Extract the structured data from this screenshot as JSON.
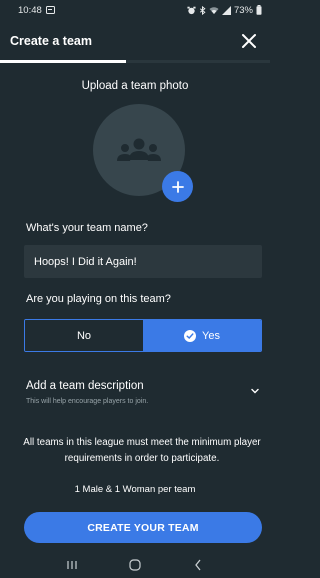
{
  "status_bar": {
    "time": "10:48",
    "battery": "73%"
  },
  "header": {
    "title": "Create a team",
    "close_icon": "close-icon"
  },
  "photo": {
    "label": "Upload a team photo",
    "placeholder_icon": "group-icon",
    "add_icon": "plus-icon"
  },
  "team_name": {
    "label": "What's your team name?",
    "value": "Hoops! I Did it Again!"
  },
  "playing": {
    "label": "Are you playing on this team?",
    "options": [
      "No",
      "Yes"
    ],
    "selected": "Yes"
  },
  "description": {
    "title": "Add a team description",
    "subtitle": "This will help encourage players to join."
  },
  "league_note": "All teams in this league must meet the minimum player requirements in order to participate.",
  "requirement": "1 Male  & 1 Woman per team",
  "create_button": "CREATE YOUR TEAM",
  "colors": {
    "background": "#1f2b31",
    "accent": "#3b7ae6",
    "input": "#2c383e"
  }
}
